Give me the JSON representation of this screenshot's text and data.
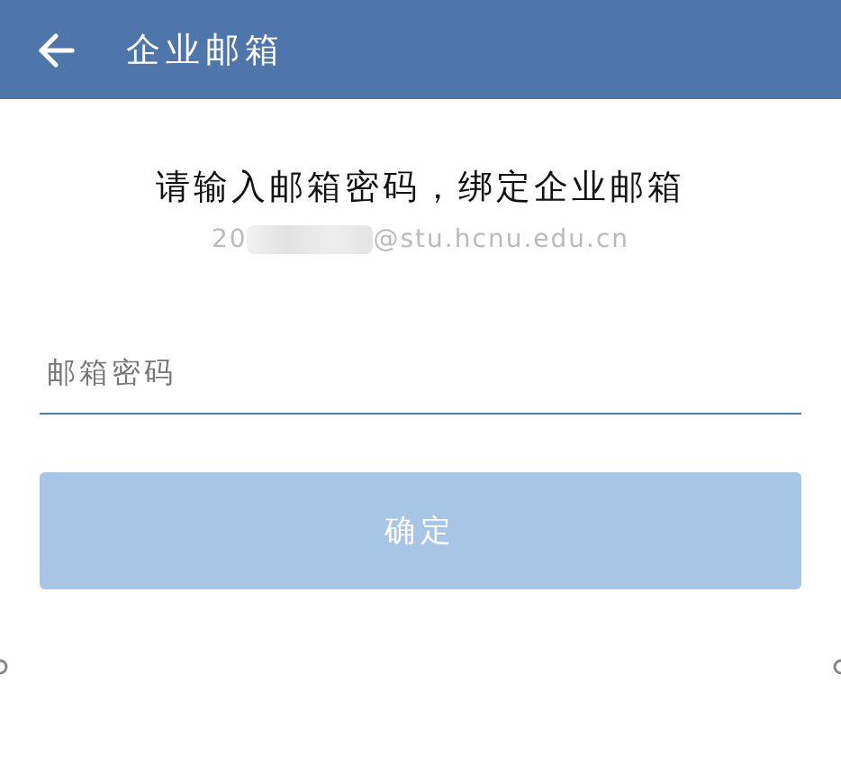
{
  "header": {
    "title": "企业邮箱"
  },
  "prompt": "请输入邮箱密码，绑定企业邮箱",
  "email": {
    "start": "20",
    "redacted": true,
    "end": "@stu.hcnu.edu.cn"
  },
  "password_field": {
    "placeholder": "邮箱密码"
  },
  "confirm_button": {
    "label": "确定",
    "disabled": true
  }
}
